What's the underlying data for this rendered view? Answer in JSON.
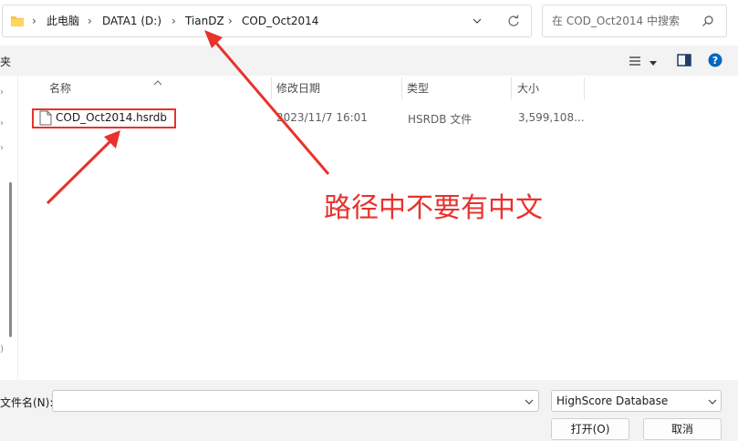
{
  "address_bar": {
    "breadcrumbs": [
      "此电脑",
      "DATA1 (D:)",
      "TianDZ",
      "COD_Oct2014"
    ]
  },
  "search": {
    "placeholder": "在 COD_Oct2014 中搜索"
  },
  "toolbar": {
    "left_cut_label": "夹"
  },
  "columns": [
    {
      "label": "名称"
    },
    {
      "label": "修改日期"
    },
    {
      "label": "类型"
    },
    {
      "label": "大小"
    }
  ],
  "files": [
    {
      "name": "COD_Oct2014.hsrdb",
      "modified": "2023/11/7 16:01",
      "type": "HSRDB 文件",
      "size": "3,599,108..."
    }
  ],
  "bottom": {
    "filename_label": "文件名(N):",
    "filename_value": "",
    "filetype_value": "HighScore Database",
    "open_button": "打开(O)",
    "cancel_button": "取消"
  },
  "annotation": {
    "text": "路径中不要有中文",
    "color": "#e8322c"
  },
  "colors": {
    "accent": "#0067c0",
    "annotation_red": "#e8322c"
  }
}
